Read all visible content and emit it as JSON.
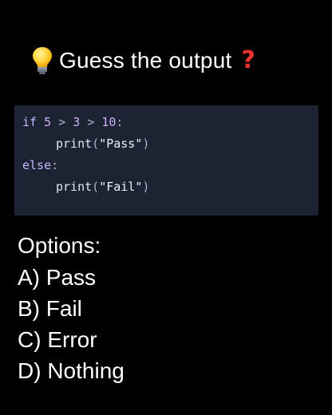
{
  "title": {
    "icon_left": "lightbulb-icon",
    "text": "Guess the output",
    "icon_right": "question-mark-icon",
    "icon_right_color": "#e8332c"
  },
  "code": {
    "background": "#1c2333",
    "lines": [
      {
        "kw": "if",
        "a": "5",
        "op1": ">",
        "b": "3",
        "op2": ">",
        "c": "10",
        "colon": ":"
      },
      {
        "fn": "print",
        "open": "(",
        "str": "\"Pass\"",
        "close": ")"
      },
      {
        "kw": "else",
        "colon": ":"
      },
      {
        "fn": "print",
        "open": "(",
        "str": "\"Fail\"",
        "close": ")"
      }
    ]
  },
  "options": {
    "heading": "Options:",
    "items": [
      "A) Pass",
      "B) Fail",
      "C) Error",
      "D) Nothing"
    ]
  }
}
